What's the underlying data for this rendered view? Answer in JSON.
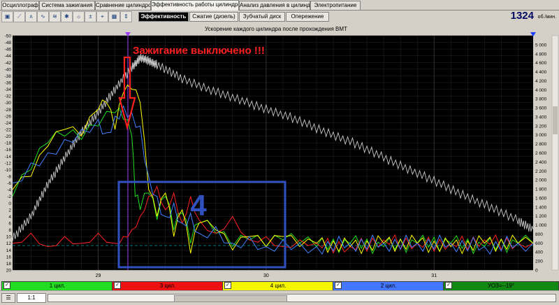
{
  "tabs": [
    {
      "label": "Осциллограф"
    },
    {
      "label": "Система зажигания"
    },
    {
      "label": "Сравнение цилиндров"
    },
    {
      "label": "Эффективность работы цилиндров"
    },
    {
      "label": "Анализ давления в цилиндре"
    },
    {
      "label": "Электропитание"
    }
  ],
  "subtabs": [
    {
      "label": "Эффективность"
    },
    {
      "label": "Сжатие (дизель)"
    },
    {
      "label": "Зубчатый диск"
    },
    {
      "label": "Опережение"
    }
  ],
  "rpm": {
    "value": "1324",
    "unit": "об./мин."
  },
  "chart_data": {
    "type": "line",
    "title": "Ускорение каждого цилиндра после прохождения ВМТ",
    "annotation": "Зажигание выключено !!!",
    "box_label": "4",
    "x_ticks": [
      "29",
      "30",
      "31"
    ],
    "x_range": [
      28.49,
      31.59
    ],
    "left_axis": {
      "range": [
        -50,
        20
      ],
      "inverted": true,
      "labels": [
        "-50",
        "-48",
        "-46",
        "-44",
        "-42",
        "-40",
        "-38",
        "-36",
        "-34",
        "-32",
        "-30",
        "-28",
        "-26",
        "-24",
        "-22",
        "-20",
        "-18",
        "-16",
        "-14",
        "-12",
        "-10",
        "-8",
        "-6",
        "-4",
        "-2",
        "0",
        "2",
        "4",
        "6",
        "8",
        "10",
        "12",
        "14",
        "16",
        "18",
        "20"
      ]
    },
    "right_axis": {
      "range": [
        0,
        5200
      ],
      "labels": [
        "0",
        "200",
        "400",
        "600",
        "800",
        "1 000",
        "1 200",
        "1 400",
        "1 600",
        "1 800",
        "2 000",
        "2 200",
        "2 400",
        "2 600",
        "2 800",
        "3 000",
        "3 200",
        "3 400",
        "3 600",
        "3 800",
        "4 000",
        "4 200",
        "4 400",
        "4 600",
        "4 800",
        "5 000"
      ]
    },
    "series": [
      {
        "name": "обороты",
        "color": "#c8c8c8",
        "axis": "right",
        "x": [
          28.49,
          28.6,
          28.7,
          28.8,
          28.9,
          29.0,
          29.1,
          29.2,
          29.25,
          29.3,
          29.35,
          29.5,
          29.7,
          29.9,
          30.1,
          30.3,
          30.5,
          30.7,
          30.9,
          31.1,
          31.3,
          31.5,
          31.59
        ],
        "y": [
          700,
          1200,
          1900,
          2500,
          3050,
          3500,
          4000,
          4500,
          4700,
          4650,
          4550,
          4250,
          3950,
          3700,
          3450,
          3150,
          2850,
          2500,
          2150,
          1800,
          1450,
          1100,
          900
        ]
      },
      {
        "name": "1 цил.",
        "color": "#20e020",
        "axis": "left",
        "x": [
          28.49,
          28.6,
          28.7,
          28.8,
          28.9,
          29.0,
          29.1,
          29.15,
          29.2,
          29.22,
          29.25,
          29.3,
          29.35,
          29.4,
          29.45,
          29.5,
          29.55,
          29.6,
          29.7,
          29.8,
          29.9,
          30.0,
          30.1,
          30.2,
          30.3,
          30.5,
          30.7,
          30.9,
          31.1,
          31.3,
          31.5,
          31.59
        ],
        "y": [
          -2,
          -10,
          -18,
          -20,
          -19,
          -23,
          -27,
          -25,
          -20,
          -2,
          2,
          -3,
          5,
          -2,
          8,
          3,
          12,
          6,
          9,
          13,
          11,
          13,
          11,
          12,
          13,
          12,
          13,
          12,
          12,
          13,
          12,
          12
        ]
      },
      {
        "name": "3 цил.",
        "color": "#ff2020",
        "axis": "left",
        "x": [
          28.49,
          28.6,
          28.7,
          28.8,
          28.9,
          29.0,
          29.1,
          29.15,
          29.2,
          29.25,
          29.3,
          29.35,
          29.4,
          29.45,
          29.5,
          29.55,
          29.6,
          29.7,
          29.8,
          29.9,
          30.0,
          30.1,
          30.2,
          30.3,
          30.5,
          30.7,
          30.9,
          31.1,
          31.3,
          31.5,
          31.59
        ],
        "y": [
          12,
          9,
          13,
          10,
          12,
          9,
          12,
          10,
          8,
          4,
          -2,
          -5,
          2,
          -3,
          6,
          -2,
          5,
          9,
          4,
          11,
          10,
          13,
          11,
          12,
          13,
          11,
          12,
          12,
          11,
          12,
          12
        ]
      },
      {
        "name": "4 цил.",
        "color": "#ffff00",
        "axis": "left",
        "x": [
          28.49,
          28.6,
          28.7,
          28.8,
          28.9,
          29.0,
          29.05,
          29.1,
          29.15,
          29.2,
          29.25,
          29.3,
          29.35,
          29.4,
          29.45,
          29.5,
          29.55,
          29.6,
          29.7,
          29.8,
          29.9,
          30.0,
          30.1,
          30.2,
          30.3,
          30.5,
          30.7,
          30.9,
          31.1,
          31.3,
          31.5,
          31.59
        ],
        "y": [
          -4,
          -8,
          -17,
          -22,
          -20,
          -28,
          -30,
          -22,
          -33,
          -34,
          -30,
          -4,
          4,
          -3,
          10,
          2,
          15,
          6,
          8,
          14,
          10,
          13,
          10,
          13,
          12,
          13,
          12,
          12,
          13,
          12,
          12,
          12
        ]
      },
      {
        "name": "2 цил.",
        "color": "#4080ff",
        "axis": "left",
        "x": [
          28.49,
          28.6,
          28.7,
          28.8,
          28.9,
          29.0,
          29.05,
          29.1,
          29.15,
          29.2,
          29.25,
          29.3,
          29.35,
          29.4,
          29.45,
          29.5,
          29.55,
          29.6,
          29.7,
          29.8,
          29.9,
          30.0,
          30.1,
          30.2,
          30.3,
          30.5,
          30.7,
          30.9,
          31.1,
          31.3,
          31.5,
          31.59
        ],
        "y": [
          -6,
          -12,
          -15,
          -19,
          -22,
          -25,
          -21,
          -26,
          -29,
          -27,
          -23,
          -8,
          -2,
          4,
          0,
          6,
          3,
          9,
          7,
          12,
          10,
          13,
          11,
          12,
          13,
          12,
          12,
          12,
          12,
          13,
          12,
          12
        ]
      }
    ]
  },
  "legend": [
    {
      "label": "1 цил.",
      "color": "#22dd22"
    },
    {
      "label": "3 цил.",
      "color": "#ee1111"
    },
    {
      "label": "4 цил.",
      "color": "#f5f500"
    },
    {
      "label": "2 цил.",
      "color": "#4477ff"
    },
    {
      "label": "УОЗ=--19°",
      "color": "#118811"
    }
  ],
  "status": {
    "zoom": "1:1"
  }
}
